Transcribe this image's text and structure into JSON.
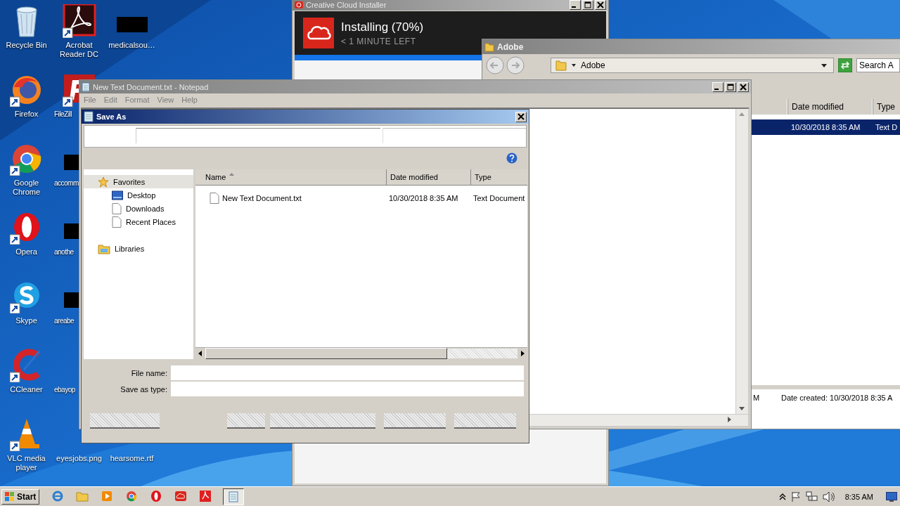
{
  "desktop_icons": [
    {
      "label": "Recycle Bin",
      "kind": "recycle"
    },
    {
      "label": "Acrobat Reader DC",
      "kind": "acrobat"
    },
    {
      "label": "medicalsou…",
      "kind": "redacted"
    },
    {
      "label": "Firefox",
      "kind": "firefox"
    },
    {
      "label": "FileZill",
      "kind": "filezilla"
    },
    {
      "label": "Google Chrome",
      "kind": "chrome"
    },
    {
      "label": "accomm",
      "kind": "redacted"
    },
    {
      "label": "Opera",
      "kind": "opera"
    },
    {
      "label": "anothe",
      "kind": "redacted"
    },
    {
      "label": "Skype",
      "kind": "skype"
    },
    {
      "label": "areabe",
      "kind": "redacted"
    },
    {
      "label": "CCleaner",
      "kind": "ccleaner"
    },
    {
      "label": "ebayop",
      "kind": "none"
    },
    {
      "label": "VLC media player",
      "kind": "vlc"
    },
    {
      "label": "eyesjobs.png",
      "kind": "none"
    },
    {
      "label": "hearsome.rtf",
      "kind": "none"
    }
  ],
  "installer": {
    "title": "Creative Cloud Installer",
    "status": "Installing (70%)",
    "time_left": "< 1 MINUTE LEFT"
  },
  "explorer": {
    "title": "Adobe",
    "address": "Adobe",
    "search": {
      "placeholder": "Search A"
    },
    "columns": [
      "Date modified",
      "Type"
    ],
    "rows": [
      {
        "date": "10/30/2018 8:35 AM",
        "type": "Text D",
        "selected": true
      }
    ],
    "status_cut": "M",
    "status": "Date created: 10/30/2018 8:35 A"
  },
  "notepad": {
    "title": "New Text Document.txt - Notepad",
    "menu": [
      "File",
      "Edit",
      "Format",
      "View",
      "Help"
    ]
  },
  "save_dialog": {
    "title": "Save As",
    "nav": [
      {
        "label": "Favorites",
        "kind": "favorites",
        "selected": true
      },
      {
        "label": "Desktop",
        "kind": "desktop",
        "selected": false
      },
      {
        "label": "Downloads",
        "kind": "page",
        "selected": false
      },
      {
        "label": "Recent Places",
        "kind": "page",
        "selected": false
      },
      {
        "label": "Libraries",
        "kind": "libraries",
        "selected": false
      }
    ],
    "columns": [
      "Name",
      "Date modified",
      "Type"
    ],
    "files": [
      {
        "name": "New Text Document.txt",
        "date": "10/30/2018 8:35 AM",
        "type": "Text Document",
        "selected": false
      }
    ],
    "file_name_label": "File name:",
    "type_label": "Save as type:"
  },
  "taskbar": {
    "start": "Start",
    "items": [
      {
        "kind": "ie",
        "selected": false
      },
      {
        "kind": "folder",
        "selected": false
      },
      {
        "kind": "media",
        "selected": false
      },
      {
        "kind": "chrome",
        "selected": false
      },
      {
        "kind": "opera",
        "selected": false
      },
      {
        "kind": "cc",
        "selected": false
      },
      {
        "kind": "acrobat",
        "selected": false
      },
      {
        "kind": "notepad",
        "selected": true
      }
    ],
    "clock": "8:35 AM"
  }
}
